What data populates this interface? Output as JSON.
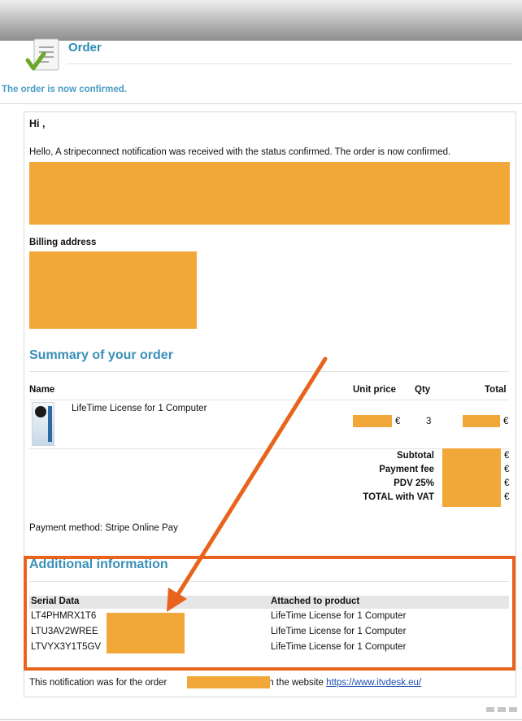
{
  "header": {
    "title": "Order",
    "confirmation": "The order is now confirmed.",
    "icon": "document-check-icon"
  },
  "email": {
    "greeting": "Hi ,",
    "hello_line": "Hello, A stripeconnect notification was received with the status confirmed. The order is now confirmed.",
    "billing_title": "Billing address",
    "summary_title": "Summary of your order",
    "table_headers": {
      "name": "Name",
      "unit_price": "Unit price",
      "qty": "Qty",
      "total": "Total"
    },
    "item": {
      "name": "LifeTime License for 1 Computer",
      "qty": "3",
      "currency": "€"
    },
    "totals": {
      "subtotal": "Subtotal",
      "payment_fee": "Payment fee",
      "pdv": "PDV 25%",
      "total_vat": "TOTAL with VAT",
      "currency": "€"
    },
    "payment_method": "Payment method: Stripe Online Pay",
    "additional_title": "Additional information",
    "serial_headers": {
      "serial": "Serial Data",
      "product": "Attached to product"
    },
    "serials": [
      {
        "serial": "LT4PHMRX1T6",
        "product": "LifeTime License for 1 Computer"
      },
      {
        "serial": "LTU3AV2WREE",
        "product": "LifeTime License for 1 Computer"
      },
      {
        "serial": "LTVYX3Y1T5GV",
        "product": "LifeTime License for 1 Computer"
      }
    ],
    "footer": {
      "prefix": "This notification was for the order",
      "middle": "on the website",
      "link": "https://www.itvdesk.eu/"
    }
  },
  "colors": {
    "accent": "#3a8fb8",
    "redaction": "#f2a838",
    "annotation": "#e8641e"
  }
}
